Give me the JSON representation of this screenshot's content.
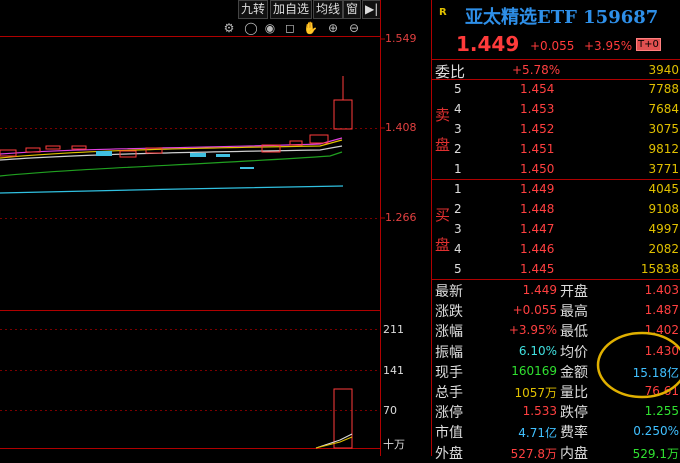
{
  "toolbar": {
    "buttons": [
      "九转",
      "加自选",
      "均线",
      "窗"
    ],
    "tools": [
      "gear-icon",
      "eye-open-icon",
      "eye-icon",
      "basket-icon",
      "hand-icon",
      "zoom-in-icon",
      "zoom-out-icon"
    ]
  },
  "chart": {
    "price_ticks": [
      "1.549",
      "1.408",
      "1.266"
    ],
    "volume_ticks": [
      "211",
      "141",
      "70",
      "十万"
    ]
  },
  "quote": {
    "badge": "R",
    "title": "亚太精选ETF 159687",
    "price": "1.449",
    "change": "+0.055",
    "change_pct": "+3.95%",
    "t0_badge": "T+0",
    "weibi_label": "委比",
    "weibi_value": "+5.78%",
    "weibi_num": "3940"
  },
  "orderbook": {
    "sell_label": [
      "卖",
      "盘"
    ],
    "buy_label": [
      "买",
      "盘"
    ],
    "sell": [
      {
        "level": "5",
        "price": "1.454",
        "vol": "7788"
      },
      {
        "level": "4",
        "price": "1.453",
        "vol": "7684"
      },
      {
        "level": "3",
        "price": "1.452",
        "vol": "3075"
      },
      {
        "level": "2",
        "price": "1.451",
        "vol": "9812"
      },
      {
        "level": "1",
        "price": "1.450",
        "vol": "3771"
      }
    ],
    "buy": [
      {
        "level": "1",
        "price": "1.449",
        "vol": "4045"
      },
      {
        "level": "2",
        "price": "1.448",
        "vol": "9108"
      },
      {
        "level": "3",
        "price": "1.447",
        "vol": "4997"
      },
      {
        "level": "4",
        "price": "1.446",
        "vol": "2082"
      },
      {
        "level": "5",
        "price": "1.445",
        "vol": "15838"
      }
    ]
  },
  "stats": [
    {
      "l1": "最新",
      "v1": "1.449",
      "c1": "#ff4040",
      "l2": "开盘",
      "v2": "1.403",
      "c2": "#ff4040"
    },
    {
      "l1": "涨跌",
      "v1": "+0.055",
      "c1": "#ff4040",
      "l2": "最高",
      "v2": "1.487",
      "c2": "#ff4040"
    },
    {
      "l1": "涨幅",
      "v1": "+3.95%",
      "c1": "#ff4040",
      "l2": "最低",
      "v2": "1.402",
      "c2": "#ff4040"
    },
    {
      "l1": "振幅",
      "v1": "6.10%",
      "c1": "#40e0e0",
      "l2": "均价",
      "v2": "1.430",
      "c2": "#ff4040"
    },
    {
      "l1": "现手",
      "v1": "160169",
      "c1": "#30e030",
      "l2": "金额",
      "v2": "15.18亿",
      "c2": "#40c0ff"
    },
    {
      "l1": "总手",
      "v1": "1057万",
      "c1": "#e0c000",
      "l2": "量比",
      "v2": "76.61",
      "c2": "#ff4040"
    },
    {
      "l1": "涨停",
      "v1": "1.533",
      "c1": "#ff4040",
      "l2": "跌停",
      "v2": "1.255",
      "c2": "#30e030"
    },
    {
      "l1": "市值",
      "v1": "4.71亿",
      "c1": "#40c0ff",
      "l2": "费率",
      "v2": "0.250%",
      "c2": "#40c0ff"
    },
    {
      "l1": "外盘",
      "v1": "527.8万",
      "c1": "#ff4040",
      "l2": "内盘",
      "v2": "529.1万",
      "c2": "#30e030"
    }
  ],
  "colors": {
    "up": "#ff4040",
    "down": "#30e030",
    "accent": "#2e8fe8",
    "highlight_circle": "#e0b000"
  }
}
